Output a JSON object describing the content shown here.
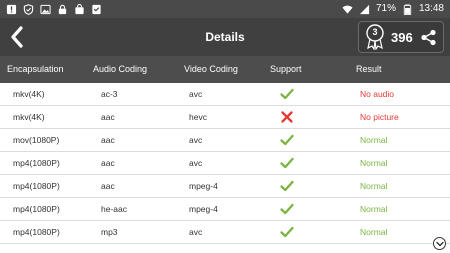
{
  "status_bar": {
    "left_icons": [
      "alert-icon",
      "shield-check-icon",
      "image-icon",
      "lock-icon",
      "bag-icon",
      "checklist-icon"
    ],
    "battery": "71%",
    "time": "13:48"
  },
  "appbar": {
    "title": "Details",
    "badge_number": "3",
    "score": "396"
  },
  "columns": {
    "encapsulation": "Encapsulation",
    "audio": "Audio Coding",
    "video": "Video Coding",
    "support": "Support",
    "result": "Result"
  },
  "rows": [
    {
      "encapsulation": "mkv(4K)",
      "audio": "ac-3",
      "video": "avc",
      "support": "check",
      "result": "No audio",
      "status": "bad"
    },
    {
      "encapsulation": "mkv(4K)",
      "audio": "aac",
      "video": "hevc",
      "support": "cross",
      "result": "No picture",
      "status": "bad"
    },
    {
      "encapsulation": "mov(1080P)",
      "audio": "aac",
      "video": "avc",
      "support": "check",
      "result": "Normal",
      "status": "good"
    },
    {
      "encapsulation": "mp4(1080P)",
      "audio": "aac",
      "video": "avc",
      "support": "check",
      "result": "Normal",
      "status": "good"
    },
    {
      "encapsulation": "mp4(1080P)",
      "audio": "aac",
      "video": "mpeg-4",
      "support": "check",
      "result": "Normal",
      "status": "good"
    },
    {
      "encapsulation": "mp4(1080P)",
      "audio": "he-aac",
      "video": "mpeg-4",
      "support": "check",
      "result": "Normal",
      "status": "good"
    },
    {
      "encapsulation": "mp4(1080P)",
      "audio": "mp3",
      "video": "avc",
      "support": "check",
      "result": "Normal",
      "status": "good"
    }
  ],
  "colors": {
    "check": "#7cb342",
    "cross": "#e53935"
  }
}
